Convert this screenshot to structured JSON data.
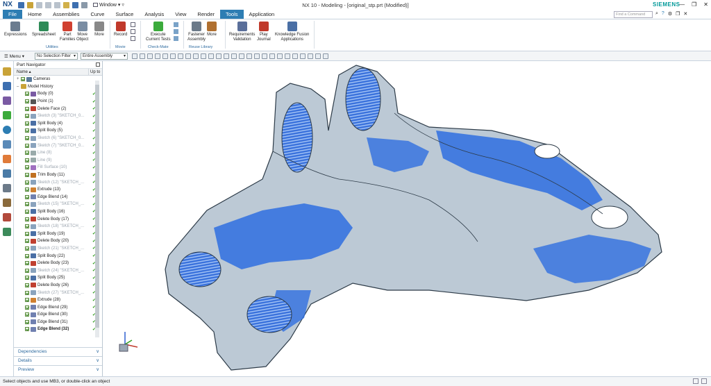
{
  "app": {
    "logo": "NX",
    "title": "NX 10 - Modeling - [original_stp.prt (Modified)]",
    "brand": "SIEMENS",
    "window_menu": "Window"
  },
  "tabs": [
    "File",
    "Home",
    "Assemblies",
    "Curve",
    "Surface",
    "Analysis",
    "View",
    "Render",
    "Tools",
    "Application"
  ],
  "active_tab": "Tools",
  "find_command_placeholder": "Find a Command",
  "ribbon": {
    "buttons": [
      {
        "name": "expressions",
        "label": "Expressions",
        "color": "#6b7c8f"
      },
      {
        "name": "spreadsheet",
        "label": "Spreadsheet",
        "color": "#2e8b57"
      },
      {
        "name": "part-families",
        "label": "Part\nFamilies",
        "color": "#d04030"
      },
      {
        "name": "move-object",
        "label": "Move\nObject",
        "color": "#7a8da3"
      },
      {
        "name": "more-utilities",
        "label": "More",
        "color": "#888888"
      },
      {
        "name": "record",
        "label": "Record",
        "color": "#c0392b"
      },
      {
        "name": "execute-current-tests",
        "label": "Execute\nCurrent Tests",
        "color": "#3cab3c"
      },
      {
        "name": "fastener-assembly",
        "label": "Fastener\nAssembly",
        "color": "#6c7a89"
      },
      {
        "name": "more-reuse",
        "label": "More",
        "color": "#b07030"
      },
      {
        "name": "requirements-validation",
        "label": "Requirements\nValidation",
        "color": "#5a6f9a"
      },
      {
        "name": "play-journal",
        "label": "Play\nJournal",
        "color": "#c0392b"
      },
      {
        "name": "knowledge-fusion-applications",
        "label": "Knowledge Fusion\nApplications",
        "color": "#4a6fa5"
      }
    ],
    "groups": [
      "Utilities",
      "Movie",
      "Check-Mate",
      "Reuse Library"
    ]
  },
  "toolbar2": {
    "menu": "Menu",
    "selection_filter": "No Selection Filter",
    "scope": "Entire Assembly"
  },
  "navigator": {
    "title": "Part Navigator",
    "col_name": "Name",
    "col_up": "Up to",
    "items": [
      {
        "label": "Cameras",
        "level": 1,
        "type": "camera",
        "exp": "+",
        "style": "normal"
      },
      {
        "label": "Model History",
        "level": 1,
        "type": "folder",
        "exp": "–",
        "style": "normal"
      },
      {
        "label": "Body (0)",
        "level": 2,
        "type": "body",
        "style": "normal"
      },
      {
        "label": "Point (1)",
        "level": 2,
        "type": "point",
        "style": "normal"
      },
      {
        "label": "Delete Face (2)",
        "level": 2,
        "type": "delete",
        "style": "normal"
      },
      {
        "label": "Sketch (3) \"SKETCH_0...",
        "level": 2,
        "type": "sketch",
        "style": "dim"
      },
      {
        "label": "Split Body (4)",
        "level": 2,
        "type": "split",
        "style": "normal"
      },
      {
        "label": "Split Body (5)",
        "level": 2,
        "type": "split",
        "style": "normal"
      },
      {
        "label": "Sketch (6) \"SKETCH_0...",
        "level": 2,
        "type": "sketch",
        "style": "dim"
      },
      {
        "label": "Sketch (7) \"SKETCH_0...",
        "level": 2,
        "type": "sketch",
        "style": "dim"
      },
      {
        "label": "Line (8)",
        "level": 2,
        "type": "line",
        "style": "dim"
      },
      {
        "label": "Line (9)",
        "level": 2,
        "type": "line",
        "style": "dim"
      },
      {
        "label": "Fill Surface (10)",
        "level": 2,
        "type": "fill",
        "style": "dim"
      },
      {
        "label": "Trim Body (11)",
        "level": 2,
        "type": "trim",
        "style": "normal"
      },
      {
        "label": "Sketch (12) \"SKETCH_...",
        "level": 2,
        "type": "sketch",
        "style": "dim"
      },
      {
        "label": "Extrude (13)",
        "level": 2,
        "type": "extrude",
        "style": "normal"
      },
      {
        "label": "Edge Blend (14)",
        "level": 2,
        "type": "blend",
        "style": "normal"
      },
      {
        "label": "Sketch (15) \"SKETCH_...",
        "level": 2,
        "type": "sketch",
        "style": "dim"
      },
      {
        "label": "Split Body (16)",
        "level": 2,
        "type": "split",
        "style": "normal"
      },
      {
        "label": "Delete Body (17)",
        "level": 2,
        "type": "delete",
        "style": "normal"
      },
      {
        "label": "Sketch (18) \"SKETCH_...",
        "level": 2,
        "type": "sketch",
        "style": "dim"
      },
      {
        "label": "Split Body (19)",
        "level": 2,
        "type": "split",
        "style": "normal"
      },
      {
        "label": "Delete Body (20)",
        "level": 2,
        "type": "delete",
        "style": "normal"
      },
      {
        "label": "Sketch (21) \"SKETCH_...",
        "level": 2,
        "type": "sketch",
        "style": "dim"
      },
      {
        "label": "Split Body (22)",
        "level": 2,
        "type": "split",
        "style": "normal"
      },
      {
        "label": "Delete Body (23)",
        "level": 2,
        "type": "delete",
        "style": "normal"
      },
      {
        "label": "Sketch (24) \"SKETCH_...",
        "level": 2,
        "type": "sketch",
        "style": "dim"
      },
      {
        "label": "Split Body (25)",
        "level": 2,
        "type": "split",
        "style": "normal"
      },
      {
        "label": "Delete Body (26)",
        "level": 2,
        "type": "delete",
        "style": "normal"
      },
      {
        "label": "Sketch (27) \"SKETCH_...",
        "level": 2,
        "type": "sketch",
        "style": "dim"
      },
      {
        "label": "Extrude (28)",
        "level": 2,
        "type": "extrude",
        "style": "normal"
      },
      {
        "label": "Edge Blend (29)",
        "level": 2,
        "type": "blend",
        "style": "normal"
      },
      {
        "label": "Edge Blend (30)",
        "level": 2,
        "type": "blend",
        "style": "normal"
      },
      {
        "label": "Edge Blend (31)",
        "level": 2,
        "type": "blend",
        "style": "normal"
      },
      {
        "label": "Edge Blend (32)",
        "level": 2,
        "type": "blend",
        "style": "bold"
      }
    ],
    "panels": [
      "Dependencies",
      "Details",
      "Preview"
    ]
  },
  "status_text": "Select objects and use MB3, or double-click an object",
  "colors": {
    "accent": "#2d7db3",
    "model_gray": "#b9c6d2",
    "model_blue": "#2f6fe0",
    "brand": "#009999"
  }
}
